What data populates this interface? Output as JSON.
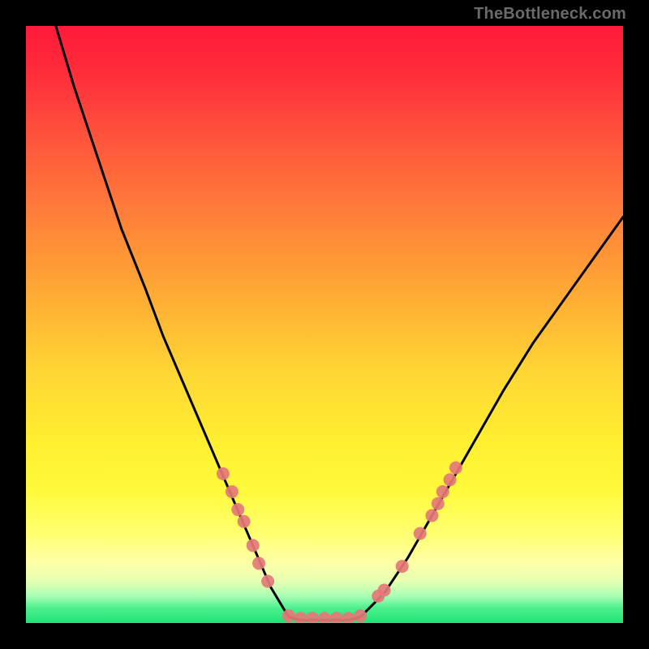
{
  "watermark": "TheBottleneck.com",
  "chart_data": {
    "type": "line",
    "title": "",
    "xlabel": "",
    "ylabel": "",
    "xlim": [
      0,
      100
    ],
    "ylim": [
      0,
      100
    ],
    "grid": false,
    "description": "V-shaped bottleneck curve on a vertical gradient background (red at top = high bottleneck, green at bottom = low). Two black curve branches descend toward a flat minimum segment near the bottom. Pink scatter markers cluster near the valley and the lower portions of both branches.",
    "series": [
      {
        "name": "left-branch",
        "type": "line",
        "color": "#000000",
        "x": [
          5,
          8,
          12,
          16,
          20,
          23,
          26,
          29,
          32,
          35,
          38,
          41,
          44
        ],
        "y": [
          100,
          90,
          78,
          66,
          56,
          48,
          41,
          34,
          27,
          20,
          13,
          6,
          1
        ]
      },
      {
        "name": "valley-floor",
        "type": "line",
        "color": "#000000",
        "x": [
          44,
          46,
          48,
          50,
          52,
          54,
          56
        ],
        "y": [
          1,
          0.5,
          0.5,
          0.5,
          0.5,
          0.5,
          1
        ]
      },
      {
        "name": "right-branch",
        "type": "line",
        "color": "#000000",
        "x": [
          56,
          60,
          64,
          68,
          72,
          76,
          80,
          85,
          90,
          95,
          100
        ],
        "y": [
          1,
          5,
          11,
          18,
          25,
          32,
          39,
          47,
          54,
          61,
          68
        ]
      }
    ],
    "scatter": [
      {
        "name": "markers",
        "color": "#e47878",
        "points": [
          {
            "x": 33,
            "y": 25
          },
          {
            "x": 34.5,
            "y": 22
          },
          {
            "x": 35.5,
            "y": 19
          },
          {
            "x": 36.5,
            "y": 17
          },
          {
            "x": 38,
            "y": 13
          },
          {
            "x": 39,
            "y": 10
          },
          {
            "x": 40.5,
            "y": 7
          },
          {
            "x": 44,
            "y": 1.2
          },
          {
            "x": 46,
            "y": 0.8
          },
          {
            "x": 48,
            "y": 0.8
          },
          {
            "x": 50,
            "y": 0.8
          },
          {
            "x": 52,
            "y": 0.8
          },
          {
            "x": 54,
            "y": 0.8
          },
          {
            "x": 56,
            "y": 1.2
          },
          {
            "x": 59,
            "y": 4.5
          },
          {
            "x": 60,
            "y": 5.5
          },
          {
            "x": 63,
            "y": 9.5
          },
          {
            "x": 66,
            "y": 15
          },
          {
            "x": 68,
            "y": 18
          },
          {
            "x": 69,
            "y": 20
          },
          {
            "x": 69.8,
            "y": 22
          },
          {
            "x": 71,
            "y": 24
          },
          {
            "x": 72,
            "y": 26
          }
        ]
      }
    ]
  }
}
